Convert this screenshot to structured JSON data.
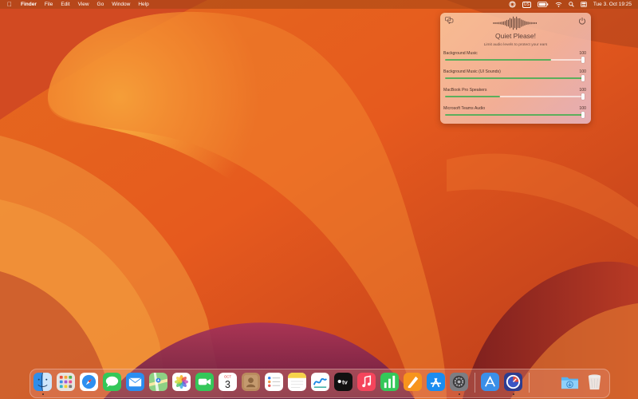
{
  "menubar": {
    "apple_icon": "apple-icon",
    "app_name": "Finder",
    "menus": [
      "File",
      "Edit",
      "View",
      "Go",
      "Window",
      "Help"
    ],
    "status_icons": [
      "quiet-please-icon",
      "input-source-badge",
      "battery-icon",
      "wifi-icon",
      "spotlight-search-icon",
      "control-center-icon"
    ],
    "input_source": "US",
    "clock": "Tue 3. Oct  19:25"
  },
  "popover": {
    "title": "Quiet Please!",
    "subtitle": "Limit audio levels to protect your ears",
    "left_icon": "chat-bubbles-icon",
    "right_icon": "power-icon",
    "sliders": [
      {
        "label": "Background Music",
        "value": "100",
        "level": 1.0,
        "fill": 0.77
      },
      {
        "label": "Background Music (UI Sounds)",
        "value": "100",
        "level": 1.0,
        "fill": 1.0
      },
      {
        "label": "MacBook Pro Speakers",
        "value": "100",
        "level": 1.0,
        "fill": 0.4
      },
      {
        "label": "Microsoft Teams Audio",
        "value": "100",
        "level": 1.0,
        "fill": 1.0
      }
    ]
  },
  "dock": {
    "calendar": {
      "month": "OCT",
      "day": "3"
    },
    "tv_label": "tv",
    "apps": [
      "Finder",
      "Launchpad",
      "Safari",
      "Messages",
      "Mail",
      "Maps",
      "Photos",
      "FaceTime",
      "Calendar",
      "Contacts",
      "Reminders",
      "Notes",
      "Freeform",
      "TV",
      "Music",
      "Numbers",
      "Pages",
      "App Store",
      "System Settings",
      "Xcode Instruments",
      "Quiet Please",
      "Downloads",
      "Trash"
    ]
  },
  "colors": {
    "accent_green": "#5cae5c",
    "menubar": "#a04614"
  }
}
